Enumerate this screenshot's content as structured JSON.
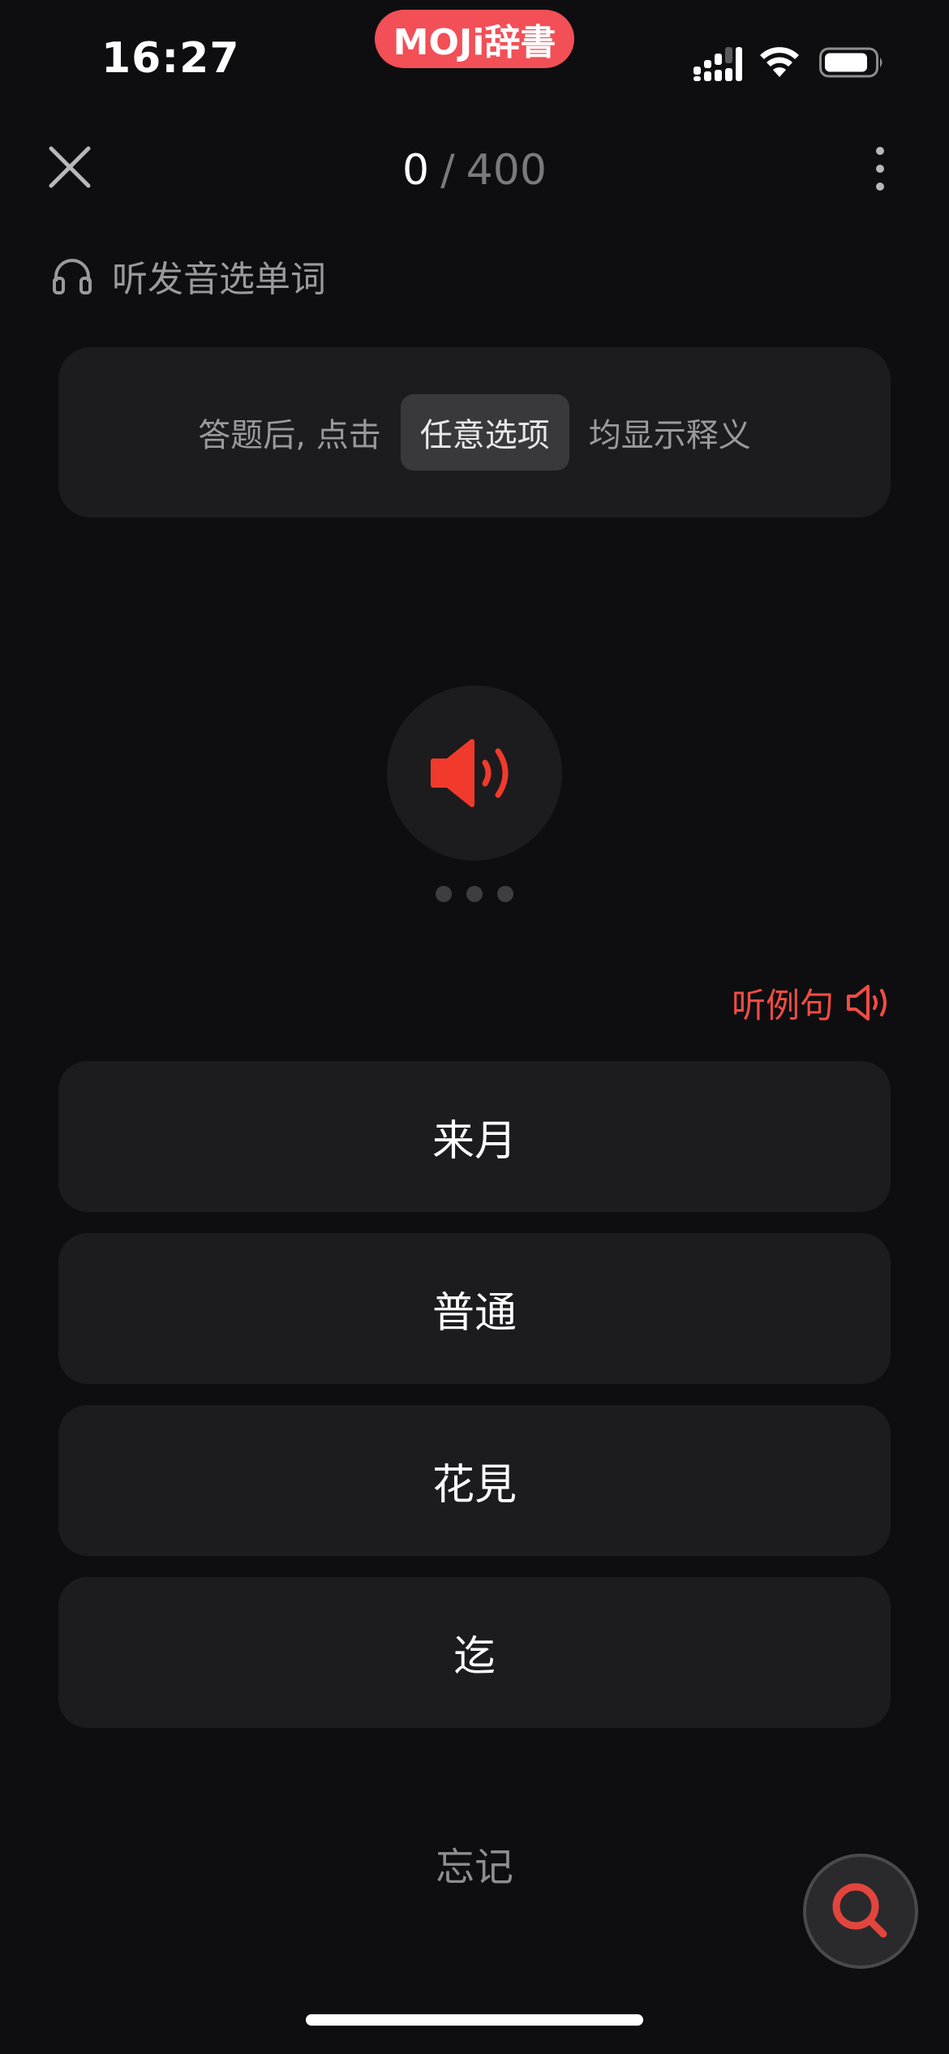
{
  "status_bar": {
    "time": "16:27",
    "app_badge": "MOJi辞書"
  },
  "nav": {
    "progress_current": "0",
    "progress_separator": "/",
    "progress_total": "400"
  },
  "mode": {
    "label": "听发音选单词",
    "icon": "headphones-icon"
  },
  "hint": {
    "prefix": "答题后, 点击",
    "chip": "任意选项",
    "suffix": "均显示释义"
  },
  "audio": {
    "icon": "speaker-icon",
    "accent_color": "#f23a2c"
  },
  "example_sentence": {
    "label": "听例句",
    "icon": "speaker-outline-icon"
  },
  "options": [
    {
      "label": "来月"
    },
    {
      "label": "普通"
    },
    {
      "label": "花見"
    },
    {
      "label": "迄"
    }
  ],
  "forget_label": "忘记",
  "colors": {
    "background": "#0e0e10",
    "card": "#1c1c1e",
    "accent": "#f24c45",
    "badge": "#f24f57"
  }
}
